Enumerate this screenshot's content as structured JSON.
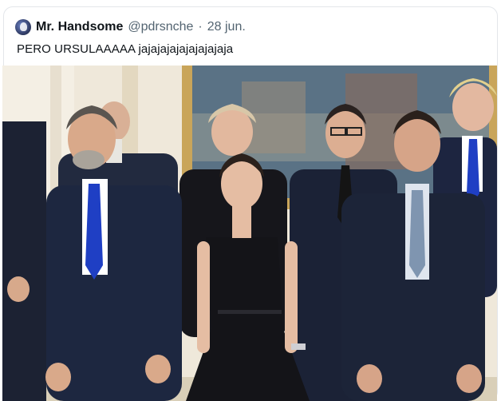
{
  "tweet": {
    "display_name": "Mr. Handsome",
    "handle": "@pdrsnche",
    "separator": "·",
    "date": "28 jun.",
    "text": "PERO URSULAAAAA jajajajajajajajajaja",
    "avatar_icon": "profile-avatar"
  },
  "photo": {
    "subject": "group-photo",
    "colors": {
      "wall": "#efe8da",
      "gold_frame": "#c9a55a",
      "suit_navy": "#1d2740",
      "tie_blue": "#1f3fc4",
      "dress_black": "#141418"
    }
  }
}
